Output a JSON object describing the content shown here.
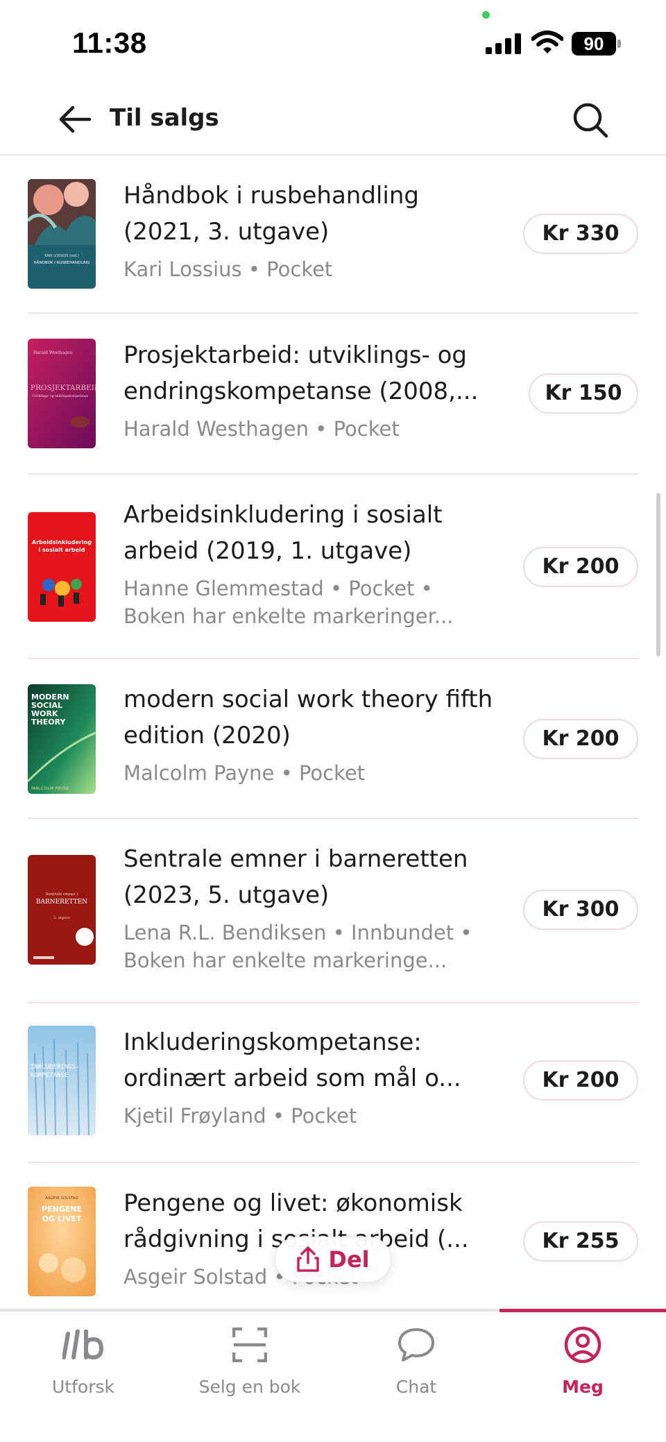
{
  "status_bar": {
    "time": "11:38",
    "battery": "90"
  },
  "header": {
    "title": "Til salgs",
    "back_icon": "arrow-left-icon",
    "search_icon": "search-icon"
  },
  "books": [
    {
      "title": "Håndbok i rusbehandling (2021, 3. utgave)",
      "meta": "Kari Lossius • Pocket",
      "price": "Kr 330"
    },
    {
      "title": "Prosjektarbeid: utviklings- og endringskompetanse (2008,...",
      "meta": "Harald Westhagen • Pocket",
      "price": "Kr 150"
    },
    {
      "title": "Arbeidsinkludering i sosialt arbeid (2019, 1. utgave)",
      "meta": "Hanne Glemmestad • Pocket • Boken har enkelte markeringer...",
      "price": "Kr 200"
    },
    {
      "title": "modern social work theory fifth edition (2020)",
      "meta": "Malcolm Payne • Pocket",
      "price": "Kr 200"
    },
    {
      "title": "Sentrale emner i barneretten (2023, 5. utgave)",
      "meta": "Lena R.L. Bendiksen • Innbundet • Boken har enkelte markeringe...",
      "price": "Kr 300"
    },
    {
      "title": "Inkluderingskompetanse: ordinært arbeid som mål o...",
      "meta": "Kjetil Frøyland • Pocket",
      "price": "Kr 200"
    },
    {
      "title": "Pengene og livet: økonomisk rådgivning i sosialt arbeid (...",
      "meta": "Asgeir Solstad • Pocket",
      "price": "Kr 255"
    }
  ],
  "covers": {
    "book1": {
      "line1": "KARI LOSSIUS (red.)",
      "line2": "HÅNDBOK I RUSBEHANDLING"
    },
    "book2": {
      "author": "Harald Westhagen",
      "title": "PROSJEKTARBEID",
      "subtitle": "Utviklings- og endringskompetanse"
    },
    "book3": {
      "line1": "Arbeidsinkludering",
      "line2": "i sosialt arbeid"
    },
    "book4": {
      "line1": "MODERN",
      "line2": "SOCIAL",
      "line3": "WORK",
      "line4": "THEORY",
      "author": "MALCOLM PAYNE"
    },
    "book5": {
      "line1": "Sentrale emner i",
      "line2": "BARNERETTEN",
      "line3": "5. utgave"
    },
    "book6": {
      "line1": "INKLUDERINGS-",
      "line2": "KOMPETANSE"
    },
    "book7": {
      "author": "ASGEIR SOLSTAD",
      "line1": "PENGENE",
      "line2": "OG LIVET"
    }
  },
  "share": {
    "label": "Del",
    "icon": "share-icon"
  },
  "nav": [
    {
      "label": "Utforsk",
      "icon": "ib-logo-icon"
    },
    {
      "label": "Selg en bok",
      "icon": "scan-icon"
    },
    {
      "label": "Chat",
      "icon": "chat-bubble-icon"
    },
    {
      "label": "Meg",
      "icon": "user-circle-icon"
    }
  ],
  "colors": {
    "accent": "#c4245b",
    "muted": "#8a8a8e",
    "divider": "#f2dfe4"
  }
}
